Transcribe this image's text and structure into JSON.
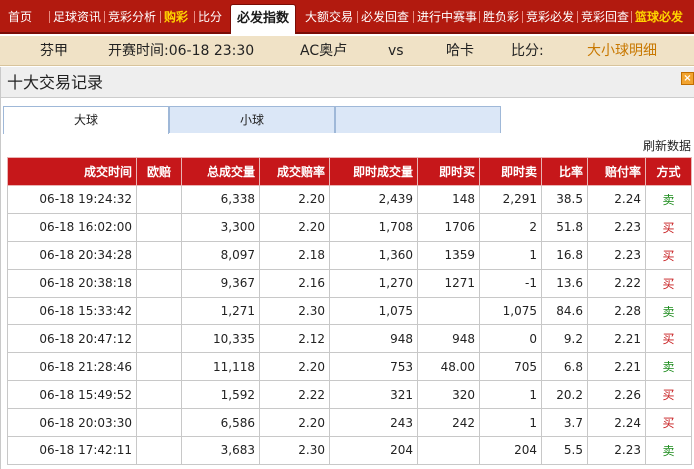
{
  "nav": {
    "items": [
      {
        "label": "首页",
        "style": "normal"
      },
      {
        "label": "足球资讯",
        "style": "normal"
      },
      {
        "label": "竞彩分析",
        "style": "normal"
      },
      {
        "label": "购彩",
        "style": "hot"
      },
      {
        "label": "比分",
        "style": "normal"
      },
      {
        "label": "必发指数",
        "style": "active"
      },
      {
        "label": "大额交易",
        "style": "normal"
      },
      {
        "label": "必发回查",
        "style": "normal"
      },
      {
        "label": "进行中赛事",
        "style": "normal"
      },
      {
        "label": "胜负彩",
        "style": "normal"
      },
      {
        "label": "竞彩必发",
        "style": "normal"
      },
      {
        "label": "竞彩回查",
        "style": "normal"
      },
      {
        "label": "篮球必发",
        "style": "hot"
      }
    ]
  },
  "match": {
    "league": "芬甲",
    "kickoff": "开赛时间:06-18 23:30",
    "home": "AC奥卢",
    "vs": "vs",
    "away": "哈卡",
    "score_label": "比分:",
    "detail_link": "大小球明细"
  },
  "panel": {
    "title": "十大交易记录",
    "close": "×",
    "tabs": [
      {
        "label": "大球",
        "active": true
      },
      {
        "label": "小球",
        "active": false
      },
      {
        "label": "",
        "active": false
      }
    ],
    "refresh": "刷新数据"
  },
  "table": {
    "headers": [
      "成交时间",
      "欧赔",
      "总成交量",
      "成交赔率",
      "即时成交量",
      "即时买",
      "即时卖",
      "比率",
      "赔付率",
      "方式"
    ],
    "rows": [
      [
        "06-18 19:24:32",
        "",
        "6,338",
        "2.20",
        "2,439",
        "148",
        "2,291",
        "38.5",
        "2.24",
        "卖"
      ],
      [
        "06-18 16:02:00",
        "",
        "3,300",
        "2.20",
        "1,708",
        "1706",
        "2",
        "51.8",
        "2.23",
        "买"
      ],
      [
        "06-18 20:34:28",
        "",
        "8,097",
        "2.18",
        "1,360",
        "1359",
        "1",
        "16.8",
        "2.23",
        "买"
      ],
      [
        "06-18 20:38:18",
        "",
        "9,367",
        "2.16",
        "1,270",
        "1271",
        "-1",
        "13.6",
        "2.22",
        "买"
      ],
      [
        "06-18 15:33:42",
        "",
        "1,271",
        "2.30",
        "1,075",
        "",
        "1,075",
        "84.6",
        "2.28",
        "卖"
      ],
      [
        "06-18 20:47:12",
        "",
        "10,335",
        "2.12",
        "948",
        "948",
        "0",
        "9.2",
        "2.21",
        "买"
      ],
      [
        "06-18 21:28:46",
        "",
        "11,118",
        "2.20",
        "753",
        "48.00",
        "705",
        "6.8",
        "2.21",
        "卖"
      ],
      [
        "06-18 15:49:52",
        "",
        "1,592",
        "2.22",
        "321",
        "320",
        "1",
        "20.2",
        "2.26",
        "买"
      ],
      [
        "06-18 20:03:30",
        "",
        "6,586",
        "2.20",
        "243",
        "242",
        "1",
        "3.7",
        "2.24",
        "买"
      ],
      [
        "06-18 17:42:11",
        "",
        "3,683",
        "2.30",
        "204",
        "",
        "204",
        "5.5",
        "2.23",
        "卖"
      ]
    ]
  }
}
